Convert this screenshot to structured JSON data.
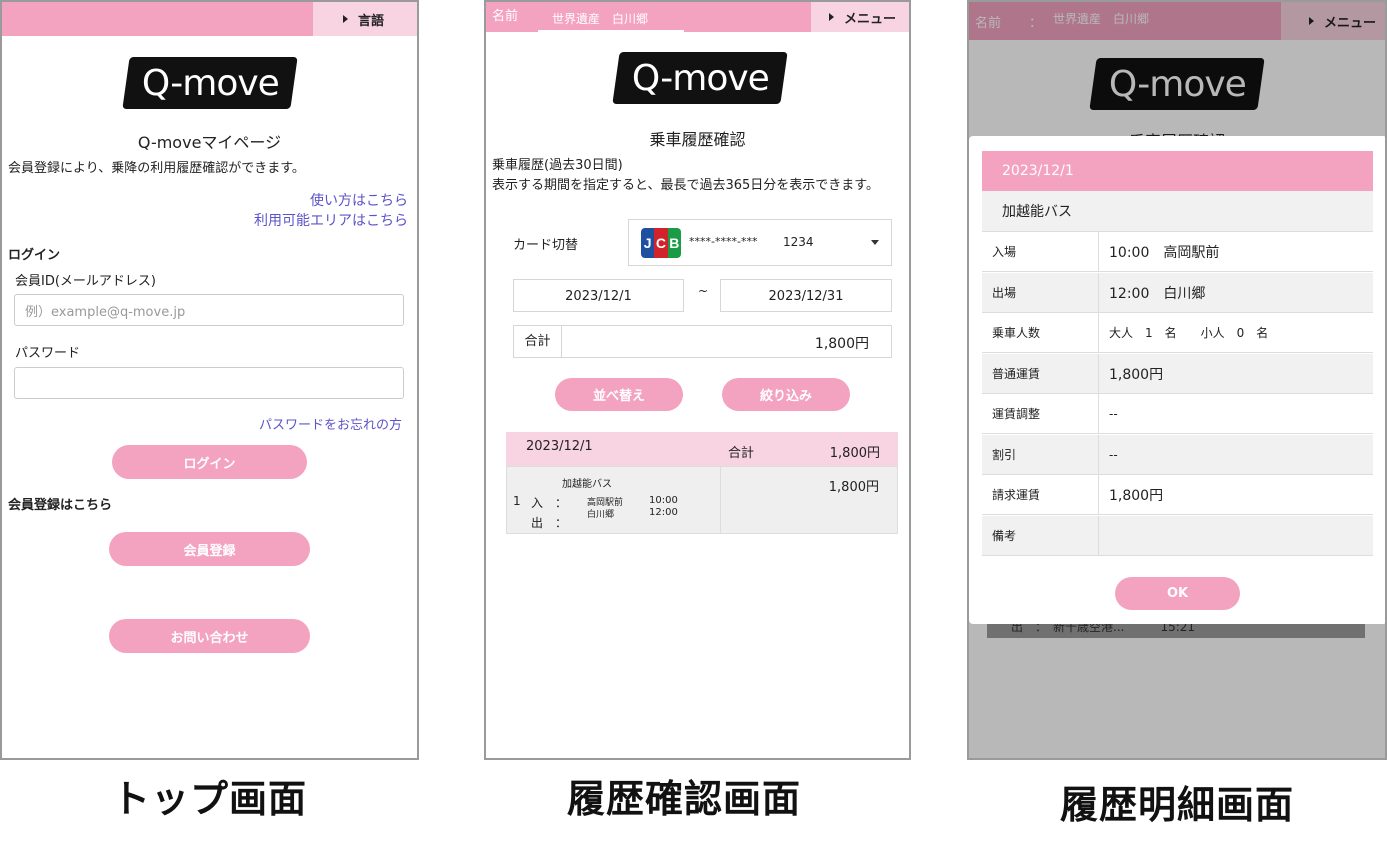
{
  "screen1": {
    "lang_label": "言語",
    "logo_text": "Q-move",
    "title": "Q-moveマイページ",
    "intro": "会員登録により、乗降の利用履歴確認ができます。",
    "link_howto": "使い方はこちら",
    "link_area": "利用可能エリアはこちら",
    "login_heading": "ログイン",
    "member_id_label": "会員ID(メールアドレス)",
    "member_id_placeholder": "例）example@q-move.jp",
    "password_label": "パスワード",
    "forgot_link": "パスワードをお忘れの方",
    "login_button": "ログイン",
    "register_heading": "会員登録はこちら",
    "register_button": "会員登録",
    "contact_button": "お問い合わせ"
  },
  "screen2": {
    "name_label": "名前",
    "name_value": "世界遺産　白川郷",
    "menu_label": "メニュー",
    "logo_text": "Q-move",
    "title": "乗車履歴確認",
    "sub1": "乗車履歴(過去30日間)",
    "sub2": "表示する期間を指定すると、最長で過去365日分を表示できます。",
    "card_label": "カード切替",
    "card_masked": "****-****-***",
    "card_last4": "1234",
    "date_from": "2023/12/1",
    "date_sep": "~",
    "date_to": "2023/12/31",
    "total_label": "合計",
    "total_value": "1,800円",
    "sort_button": "並べ替え",
    "filter_button": "絞り込み",
    "history": {
      "date": "2023/12/1",
      "total_label": "合計",
      "total_value": "1,800円",
      "row": {
        "index": "1",
        "operator": "加越能バス",
        "in_label": "入　：",
        "out_label": "出　：",
        "in_stop": "高岡駅前",
        "out_stop": "白川郷",
        "in_time": "10:00",
        "out_time": "12:00",
        "fare": "1,800円"
      }
    }
  },
  "screen3": {
    "name_label": "名前",
    "name_colon": "：",
    "name_value": "世界遺産　白川郷",
    "menu_label": "メニュー",
    "logo_text": "Q-move",
    "behind_title": "乗車履歴確認",
    "behind_row": "出　：　新千歳空港...　　　15:21",
    "modal": {
      "date": "2023/12/1",
      "operator": "加越能バス",
      "rows": [
        {
          "key": "入場",
          "value": "10:00　高岡駅前"
        },
        {
          "key": "出場",
          "value": "12:00　白川郷"
        },
        {
          "key": "乗車人数",
          "value": "大人　1　名　　小人　0　名"
        },
        {
          "key": "普通運賃",
          "value": "1,800円"
        },
        {
          "key": "運賃調整",
          "value": "--"
        },
        {
          "key": "割引",
          "value": "--"
        },
        {
          "key": "請求運賃",
          "value": "1,800円"
        },
        {
          "key": "備考",
          "value": ""
        }
      ],
      "ok_button": "OK"
    }
  },
  "captions": {
    "top": "トップ画面",
    "history": "履歴確認画面",
    "detail": "履歴明細画面"
  },
  "colors": {
    "pink": "#f3a3c0",
    "light_pink": "#f8d3e1",
    "link": "#5b54c9",
    "jcb_blue": "#1e4fa0",
    "jcb_red": "#d2232a",
    "jcb_green": "#1a9b46"
  }
}
